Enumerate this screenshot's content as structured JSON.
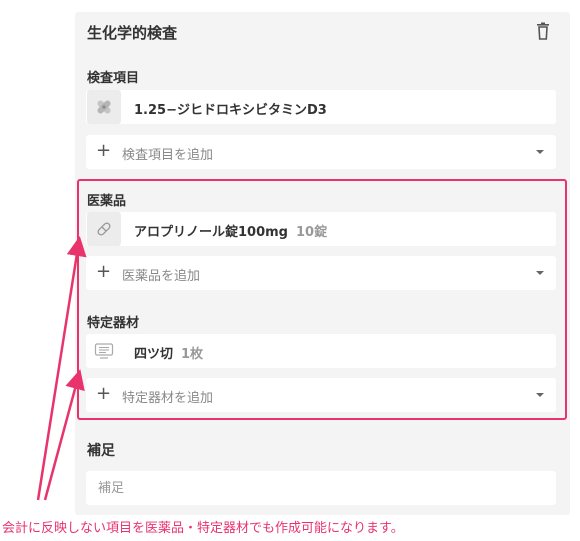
{
  "card": {
    "title": "生化学的検査"
  },
  "exam_items": {
    "label": "検査項目",
    "item": {
      "name": "1.25−ジヒドロキシビタミンD3",
      "icon": "bandage-icon"
    },
    "add_label": "検査項目を追加"
  },
  "medicines": {
    "label": "医薬品",
    "item": {
      "name": "アロプリノール錠100mg",
      "quantity": "10錠",
      "icon": "pill-icon"
    },
    "add_label": "医薬品を追加"
  },
  "materials": {
    "label": "特定器材",
    "item": {
      "name": "四ツ切",
      "quantity": "1枚",
      "icon": "film-icon"
    },
    "add_label": "特定器材を追加"
  },
  "supplement": {
    "label": "補足",
    "placeholder": "補足"
  },
  "annotation": {
    "caption": "会計に反映しない項目を医薬品・特定器材でも作成可能になります。",
    "color": "#e8336d"
  }
}
